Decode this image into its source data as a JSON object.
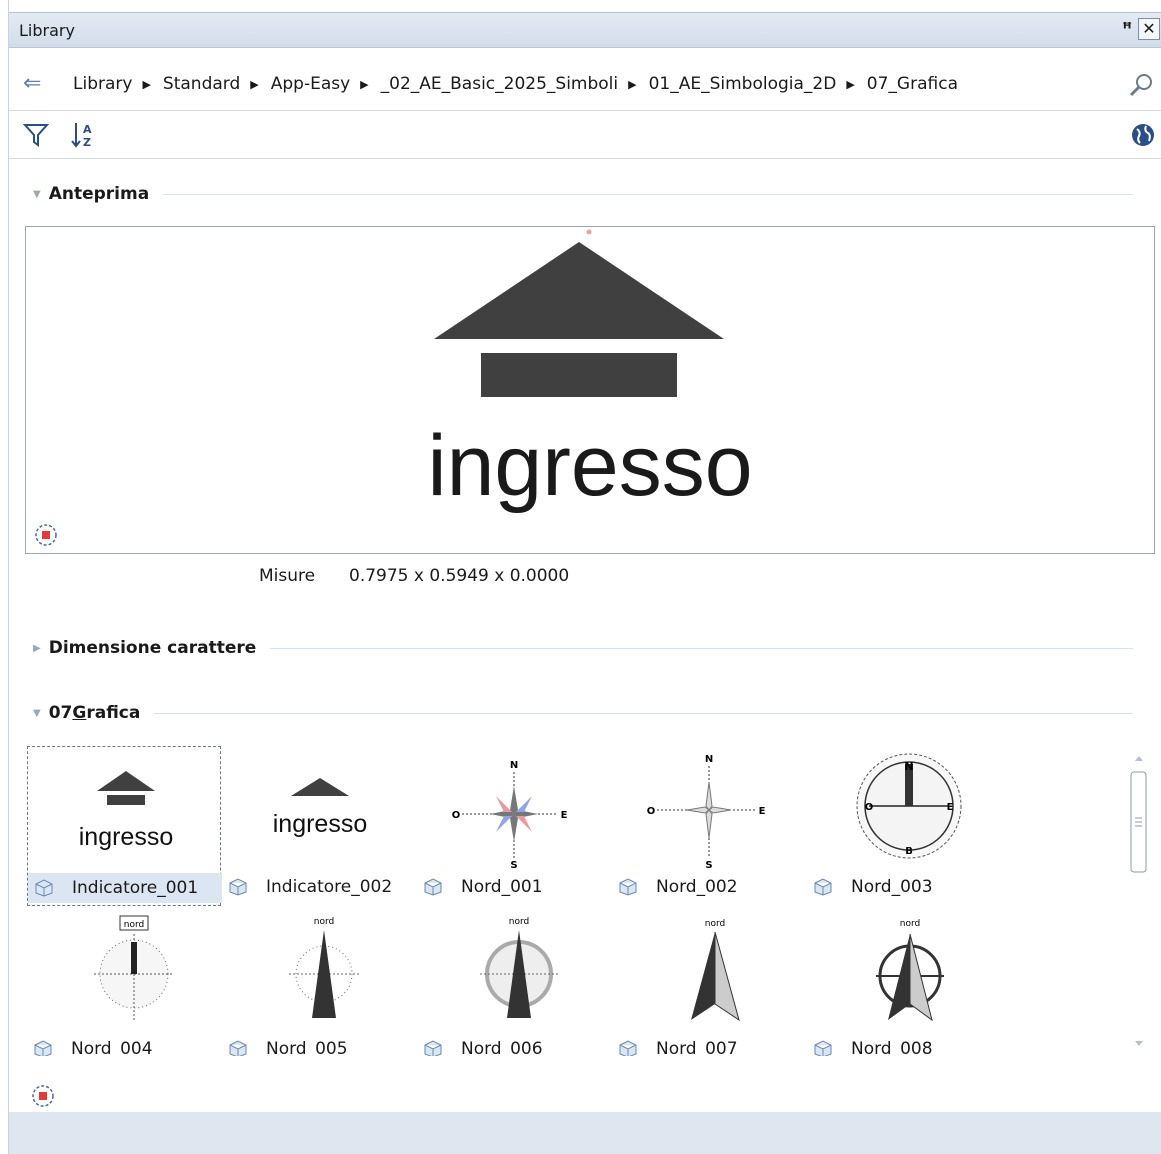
{
  "window": {
    "title": "Library",
    "pin_label": "ꟸ",
    "close_label": "✕"
  },
  "breadcrumb": {
    "items": [
      "Library",
      "Standard",
      "App-Easy",
      "_02_AE_Basic_2025_Simboli",
      "01_AE_Simbologia_2D",
      "07_Grafica"
    ]
  },
  "toolbar": {
    "sort_label": "↓A/Z"
  },
  "preview_section": {
    "header": "Anteprima",
    "preview_text": "ingresso",
    "misure_label": "Misure",
    "misure_value": "0.7975 x 0.5949 x 0.0000"
  },
  "dimensione_section": {
    "header": "Dimensione carattere"
  },
  "grafica_section": {
    "header_prefix": "07",
    "header_underlined": "G",
    "header_suffix": "rafica",
    "items": [
      {
        "label": "Indicatore_001",
        "thumb_text": "ingresso",
        "selected": true
      },
      {
        "label": "Indicatore_002",
        "thumb_text": "ingresso"
      },
      {
        "label": "Nord_001",
        "thumb_text": "N E S O"
      },
      {
        "label": "Nord_002",
        "thumb_text": "N E S O"
      },
      {
        "label": "Nord_003",
        "thumb_text": "N E B O"
      },
      {
        "label": "Nord_004",
        "thumb_text": "nord"
      },
      {
        "label": "Nord_005",
        "thumb_text": "nord"
      },
      {
        "label": "Nord_006",
        "thumb_text": "nord"
      },
      {
        "label": "Nord_007",
        "thumb_text": "nord"
      },
      {
        "label": "Nord_008",
        "thumb_text": "nord"
      }
    ]
  },
  "colors": {
    "accent": "#2b4f85",
    "preview_fill": "#404040",
    "selected_bg": "#dce6f2"
  }
}
